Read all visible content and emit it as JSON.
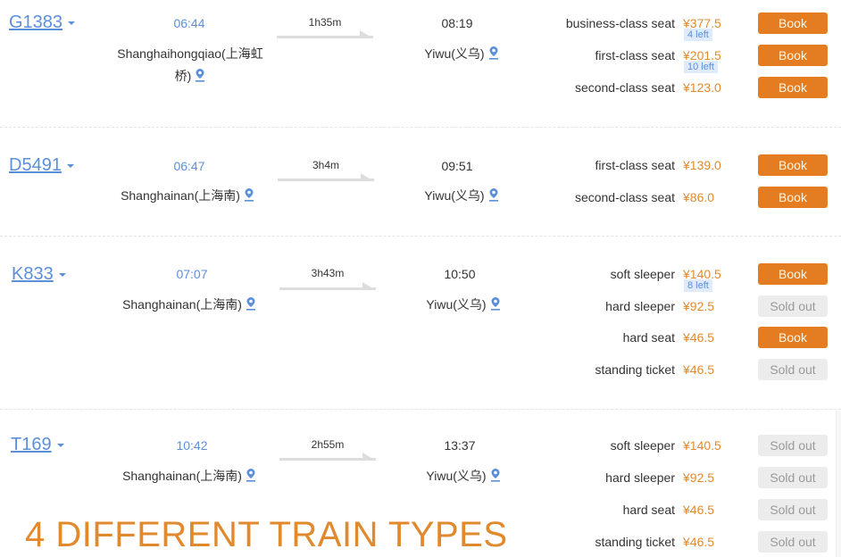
{
  "colors": {
    "train_link": "#5b8fd9",
    "price": "#e08a2d",
    "book_button": "#e47d21",
    "sold_out_button": "#ececec",
    "left_badge_bg": "#dfeafb"
  },
  "icons": {
    "location": "map-pin-icon",
    "expand": "caret-down-icon",
    "direction": "arrow-right-icon"
  },
  "trains": [
    {
      "number": "G1383",
      "departure_time": "06:44",
      "duration": "1h35m",
      "arrival_time": "08:19",
      "from_station": "Shanghaihongqiao(上海虹桥)",
      "to_station": "Yiwu(义乌)",
      "seats": [
        {
          "name": "business-class seat",
          "price": "¥377.5",
          "left": "4 left",
          "action": "Book"
        },
        {
          "name": "first-class seat",
          "price": "¥201.5",
          "left": "10 left",
          "action": "Book"
        },
        {
          "name": "second-class seat",
          "price": "¥123.0",
          "left": null,
          "action": "Book"
        }
      ]
    },
    {
      "number": "D5491",
      "departure_time": "06:47",
      "duration": "3h4m",
      "arrival_time": "09:51",
      "from_station": "Shanghainan(上海南)",
      "to_station": "Yiwu(义乌)",
      "seats": [
        {
          "name": "first-class seat",
          "price": "¥139.0",
          "left": null,
          "action": "Book"
        },
        {
          "name": "second-class seat",
          "price": "¥86.0",
          "left": null,
          "action": "Book"
        }
      ]
    },
    {
      "number": "K833",
      "departure_time": "07:07",
      "duration": "3h43m",
      "arrival_time": "10:50",
      "from_station": "Shanghainan(上海南)",
      "to_station": "Yiwu(义乌)",
      "seats": [
        {
          "name": "soft sleeper",
          "price": "¥140.5",
          "left": "8 left",
          "action": "Book"
        },
        {
          "name": "hard sleeper",
          "price": "¥92.5",
          "left": null,
          "action": "Sold out"
        },
        {
          "name": "hard seat",
          "price": "¥46.5",
          "left": null,
          "action": "Book"
        },
        {
          "name": "standing ticket",
          "price": "¥46.5",
          "left": null,
          "action": "Sold out"
        }
      ]
    },
    {
      "number": "T169",
      "departure_time": "10:42",
      "duration": "2h55m",
      "arrival_time": "13:37",
      "from_station": "Shanghainan(上海南)",
      "to_station": "Yiwu(义乌)",
      "seats": [
        {
          "name": "soft sleeper",
          "price": "¥140.5",
          "left": null,
          "action": "Sold out"
        },
        {
          "name": "hard sleeper",
          "price": "¥92.5",
          "left": null,
          "action": "Sold out"
        },
        {
          "name": "hard seat",
          "price": "¥46.5",
          "left": null,
          "action": "Sold out"
        },
        {
          "name": "standing ticket",
          "price": "¥46.5",
          "left": null,
          "action": "Sold out"
        }
      ]
    }
  ],
  "caption": "4 DIFFERENT TRAIN TYPES"
}
